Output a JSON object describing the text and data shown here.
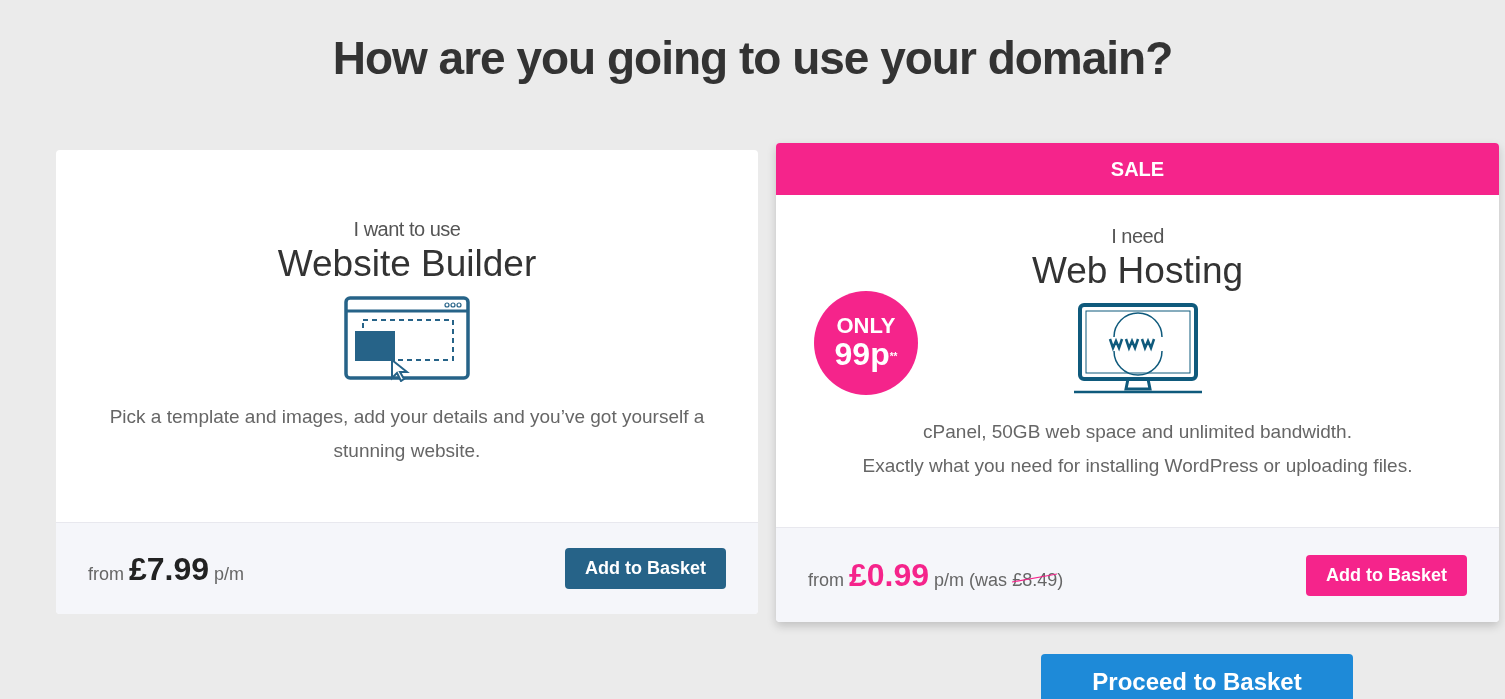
{
  "heading": "How are you going to use your domain?",
  "cards": [
    {
      "kind": "standard",
      "intro": "I want to use",
      "title": "Website Builder",
      "description": [
        "Pick a template and images, add your details and you’ve got yourself a stunning website."
      ],
      "price_prefix": "from",
      "price": "£7.99",
      "price_suffix": "p/m",
      "button": "Add to Basket"
    },
    {
      "kind": "sale",
      "banner": "SALE",
      "intro": "I need",
      "title": "Web Hosting",
      "badge": {
        "line1": "ONLY",
        "line2": "99p",
        "mark": "**"
      },
      "description": [
        "cPanel, 50GB web space and unlimited bandwidth.",
        "Exactly what you need for installing WordPress or uploading files."
      ],
      "price_prefix": "from",
      "price": "£0.99",
      "price_suffix": "p/m",
      "was_open": "(was",
      "was_price": "£8.49",
      "was_close": ")",
      "button": "Add to Basket"
    }
  ],
  "proceed_button": "Proceed to Basket"
}
